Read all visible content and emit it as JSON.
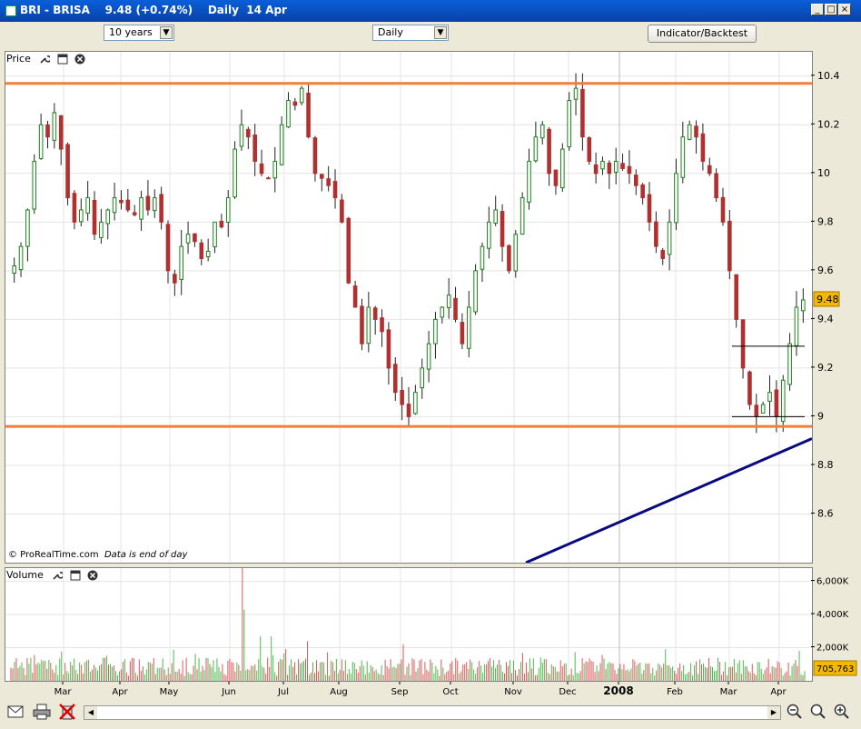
{
  "window": {
    "title": "BRI - BRISA    9.48 (+0.74%)    Daily  14 Apr",
    "controls": [
      "minimize",
      "restore",
      "close"
    ]
  },
  "toolbar": {
    "period_select": "10 years",
    "interval_select": "Daily",
    "indicator_button": "Indicator/Backtest"
  },
  "price_panel": {
    "label": "Price",
    "copyright": "© ProRealTime.com",
    "data_note": "Data is end of day",
    "last_price_badge": "9.48",
    "icons": [
      "wrench-icon",
      "window-icon",
      "close-icon"
    ]
  },
  "volume_panel": {
    "label": "Volume",
    "last_volume_badge": "705,763",
    "icons": [
      "wrench-icon",
      "window-icon",
      "close-icon"
    ]
  },
  "x_axis": {
    "labels": [
      "Mar",
      "Apr",
      "May",
      "Jun",
      "Jul",
      "Aug",
      "Sep",
      "Oct",
      "Nov",
      "Dec",
      "2008",
      "Feb",
      "Mar",
      "Apr"
    ]
  },
  "colors": {
    "up_candle": "#1E7F1E",
    "down_candle": "#B03030",
    "resistance_line": "#F07F3C",
    "trend_line": "#0A0A80",
    "badge_price": "#F5B800",
    "badge_volume": "#F5B800",
    "volume_up": "#4CBB4C",
    "volume_down": "#D65A5A"
  },
  "statusbar": {
    "icons": [
      "envelope-icon",
      "print-icon",
      "delete-icon",
      "zoom-out-icon",
      "zoom-fit-icon",
      "zoom-in-icon"
    ]
  },
  "chart_data": [
    {
      "type": "candlestick",
      "title": "BRI - BRISA",
      "xlabel": "",
      "ylabel": "",
      "ylim": [
        8.4,
        10.5
      ],
      "yticks": [
        8.6,
        8.8,
        9,
        9.2,
        9.4,
        9.6,
        9.8,
        10,
        10.2,
        10.4
      ],
      "x_ticks": [
        "Mar",
        "Apr",
        "May",
        "Jun",
        "Jul",
        "Aug",
        "Sep",
        "Oct",
        "Nov",
        "Dec",
        "2008",
        "Feb",
        "Mar",
        "Apr"
      ],
      "grid": true,
      "close_series": [
        9.62,
        9.7,
        9.85,
        10.05,
        10.2,
        10.15,
        10.25,
        10.1,
        9.9,
        9.8,
        9.85,
        9.9,
        9.75,
        9.8,
        9.85,
        9.9,
        9.88,
        9.85,
        9.83,
        9.9,
        9.85,
        9.9,
        9.8,
        9.6,
        9.55,
        9.7,
        9.75,
        9.72,
        9.65,
        9.68,
        9.8,
        9.78,
        9.9,
        10.1,
        10.2,
        10.15,
        10.05,
        10.0,
        9.98,
        10.05,
        10.2,
        10.3,
        10.28,
        10.35,
        10.15,
        10.0,
        9.98,
        9.95,
        9.9,
        9.8,
        9.55,
        9.45,
        9.3,
        9.45,
        9.4,
        9.35,
        9.2,
        9.1,
        9.05,
        9.0,
        9.1,
        9.2,
        9.3,
        9.4,
        9.45,
        9.5,
        9.4,
        9.3,
        9.45,
        9.6,
        9.7,
        9.8,
        9.85,
        9.7,
        9.6,
        9.75,
        9.9,
        10.05,
        10.15,
        10.2,
        10.0,
        9.95,
        10.1,
        10.3,
        10.35,
        10.15,
        10.05,
        10.0,
        10.05,
        10.0,
        10.05,
        10.02,
        10.0,
        9.95,
        9.9,
        9.8,
        9.7,
        9.65,
        9.8,
        10.0,
        10.15,
        10.2,
        10.15,
        10.05,
        10.0,
        9.9,
        9.8,
        9.6,
        9.4,
        9.2,
        9.05,
        9.0,
        9.05,
        9.1,
        9.0,
        9.15,
        9.3,
        9.45,
        9.48
      ],
      "resistance_level": 10.37,
      "support_level": 8.96,
      "range_box": [
        9.0,
        9.29
      ],
      "last_price": 9.48
    },
    {
      "type": "bar",
      "title": "Volume",
      "yticks": [
        "2,000K",
        "4,000K",
        "6,000K"
      ],
      "ylim": [
        0,
        6800
      ],
      "last_value": "705,763"
    }
  ]
}
